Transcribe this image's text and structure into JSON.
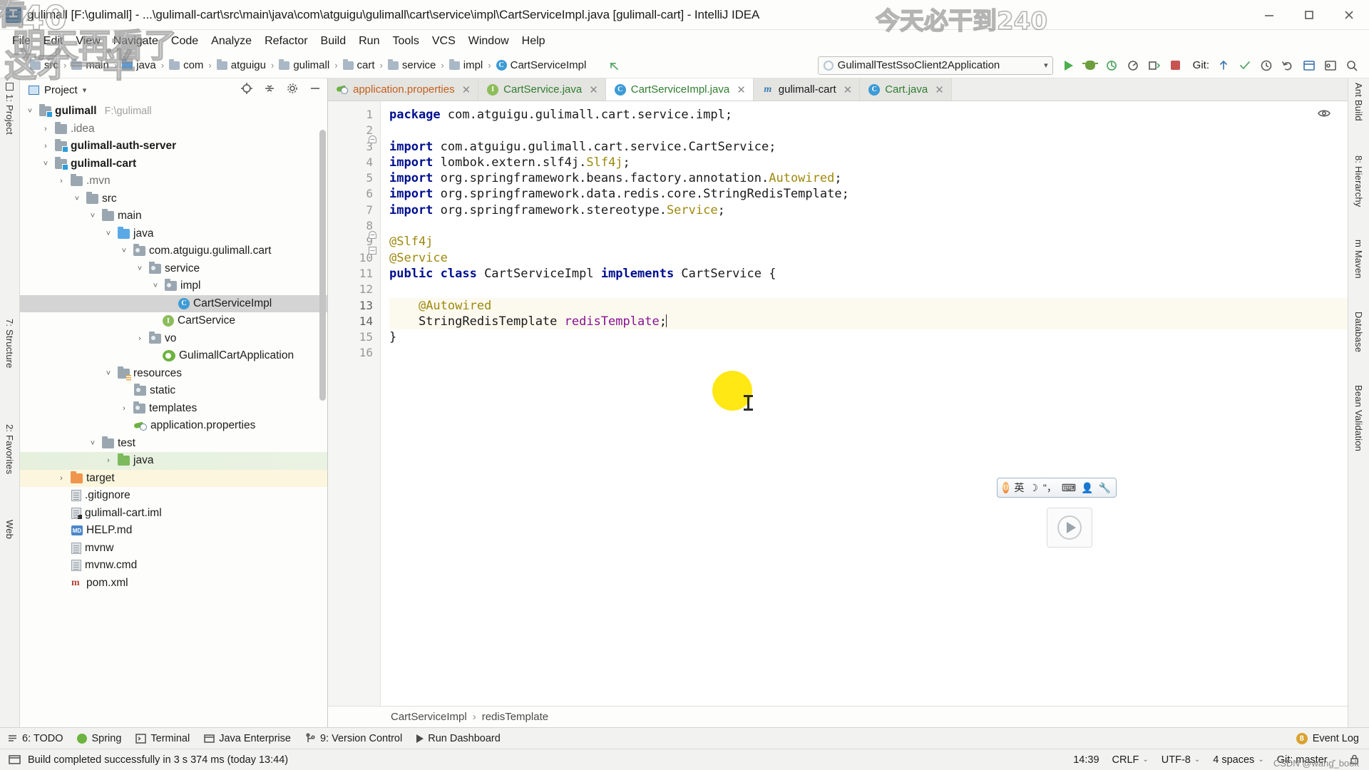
{
  "window": {
    "title": "gulimall [F:\\gulimall] - ...\\gulimall-cart\\src\\main\\java\\com\\atguigu\\gulimall\\cart\\service\\impl\\CartServiceImpl.java [gulimall-cart] - IntelliJ IDEA",
    "minimize": "–",
    "maximize": "□",
    "close": "✕"
  },
  "menubar": {
    "items": [
      {
        "label": "File"
      },
      {
        "label": "Edit"
      },
      {
        "label": "View"
      },
      {
        "label": "Navigate"
      },
      {
        "label": "Code"
      },
      {
        "label": "Analyze"
      },
      {
        "label": "Refactor"
      },
      {
        "label": "Build"
      },
      {
        "label": "Run"
      },
      {
        "label": "Tools"
      },
      {
        "label": "VCS"
      },
      {
        "label": "Window"
      },
      {
        "label": "Help"
      }
    ]
  },
  "navbar": {
    "crumbs": [
      {
        "label": "src",
        "icon": "folder-icon"
      },
      {
        "label": "main",
        "icon": "folder-icon"
      },
      {
        "label": "java",
        "icon": "folder-blue-icon"
      },
      {
        "label": "com",
        "icon": "folder-icon"
      },
      {
        "label": "atguigu",
        "icon": "folder-icon"
      },
      {
        "label": "gulimall",
        "icon": "folder-icon"
      },
      {
        "label": "cart",
        "icon": "folder-icon"
      },
      {
        "label": "service",
        "icon": "folder-icon"
      },
      {
        "label": "impl",
        "icon": "folder-icon"
      },
      {
        "label": "CartServiceImpl",
        "icon": "class-icon"
      }
    ],
    "separator": "›",
    "run_configuration": "GulimallTestSsoClient2Application",
    "run_config_caret": "▾",
    "git_label": "Git:"
  },
  "project_panel": {
    "title": "Project",
    "title_caret": "▾",
    "tree": [
      {
        "label": "gulimall",
        "sub": "F:\\gulimall",
        "twisty": "˅",
        "icon": "module-folder-icon",
        "indent": 0,
        "bold": true
      },
      {
        "label": ".idea",
        "sub": "",
        "twisty": "›",
        "icon": "folder-icon",
        "indent": 1,
        "bold": false,
        "muted": true
      },
      {
        "label": "gulimall-auth-server",
        "sub": "",
        "twisty": "›",
        "icon": "module-folder-icon",
        "indent": 1,
        "bold": true
      },
      {
        "label": "gulimall-cart",
        "sub": "",
        "twisty": "˅",
        "icon": "module-folder-icon",
        "indent": 1,
        "bold": true
      },
      {
        "label": ".mvn",
        "sub": "",
        "twisty": "›",
        "icon": "folder-icon",
        "indent": 2,
        "bold": false,
        "muted": true
      },
      {
        "label": "src",
        "sub": "",
        "twisty": "˅",
        "icon": "folder-icon",
        "indent": 2,
        "bold": false
      },
      {
        "label": "main",
        "sub": "",
        "twisty": "˅",
        "icon": "folder-icon",
        "indent": 3,
        "bold": false
      },
      {
        "label": "java",
        "sub": "",
        "twisty": "˅",
        "icon": "folder-blue-icon",
        "indent": 4,
        "bold": false
      },
      {
        "label": "com.atguigu.gulimall.cart",
        "sub": "",
        "twisty": "˅",
        "icon": "package-icon",
        "indent": 5,
        "bold": false
      },
      {
        "label": "service",
        "sub": "",
        "twisty": "˅",
        "icon": "package-icon",
        "indent": 6,
        "bold": false
      },
      {
        "label": "impl",
        "sub": "",
        "twisty": "˅",
        "icon": "package-icon",
        "indent": 7,
        "bold": false
      },
      {
        "label": "CartServiceImpl",
        "sub": "",
        "twisty": "",
        "icon": "java-class-icon",
        "indent": 8,
        "bold": false,
        "state": "selected",
        "color": "green"
      },
      {
        "label": "CartService",
        "sub": "",
        "twisty": "",
        "icon": "java-interface-icon",
        "indent": 8,
        "bold": false,
        "color": "green"
      },
      {
        "label": "vo",
        "sub": "",
        "twisty": "›",
        "icon": "package-icon",
        "indent": 7,
        "bold": false
      },
      {
        "label": "GulimallCartApplication",
        "sub": "",
        "twisty": "",
        "icon": "spring-boot-icon",
        "indent": 8,
        "bold": false,
        "color": "orange"
      },
      {
        "label": "resources",
        "sub": "",
        "twisty": "˅",
        "icon": "resources-folder-icon",
        "indent": 4,
        "bold": false
      },
      {
        "label": "static",
        "sub": "",
        "twisty": "",
        "icon": "package-icon",
        "indent": 5,
        "bold": false
      },
      {
        "label": "templates",
        "sub": "",
        "twisty": "›",
        "icon": "package-icon",
        "indent": 5,
        "bold": false
      },
      {
        "label": "application.properties",
        "sub": "",
        "twisty": "",
        "icon": "spring-properties-icon",
        "indent": 5,
        "bold": false,
        "color": "orange"
      },
      {
        "label": "test",
        "sub": "",
        "twisty": "˅",
        "icon": "folder-icon",
        "indent": 3,
        "bold": false
      },
      {
        "label": "java",
        "sub": "",
        "twisty": "›",
        "icon": "folder-green-icon",
        "indent": 4,
        "bold": false,
        "state": "green-bg"
      },
      {
        "label": "target",
        "sub": "",
        "twisty": "›",
        "icon": "folder-orange-icon",
        "indent": 2,
        "bold": false,
        "state": "yellow-bg"
      },
      {
        "label": ".gitignore",
        "sub": "",
        "twisty": "",
        "icon": "file-icon",
        "indent": 3,
        "bold": false
      },
      {
        "label": "gulimall-cart.iml",
        "sub": "",
        "twisty": "",
        "icon": "iml-file-icon",
        "indent": 3,
        "bold": false
      },
      {
        "label": "HELP.md",
        "sub": "",
        "twisty": "",
        "icon": "markdown-icon",
        "indent": 3,
        "bold": false
      },
      {
        "label": "mvnw",
        "sub": "",
        "twisty": "",
        "icon": "file-icon",
        "indent": 3,
        "bold": false
      },
      {
        "label": "mvnw.cmd",
        "sub": "",
        "twisty": "",
        "icon": "file-icon",
        "indent": 3,
        "bold": false
      },
      {
        "label": "pom.xml",
        "sub": "",
        "twisty": "",
        "icon": "maven-icon",
        "indent": 3,
        "bold": false
      }
    ]
  },
  "left_rail": [
    {
      "label": "1: Project"
    },
    {
      "label": "7: Structure"
    },
    {
      "label": "2: Favorites"
    },
    {
      "label": "Web"
    }
  ],
  "right_rail": [
    {
      "label": "Ant Build"
    },
    {
      "label": "8: Hierarchy"
    },
    {
      "label": "m Maven"
    },
    {
      "label": "Database"
    },
    {
      "label": "Bean Validation"
    }
  ],
  "editor": {
    "tabs": [
      {
        "label": "application.properties",
        "icon": "spring-properties-icon",
        "active": false,
        "close": "✕"
      },
      {
        "label": "CartService.java",
        "icon": "java-interface-icon",
        "active": false,
        "close": "✕"
      },
      {
        "label": "CartServiceImpl.java",
        "icon": "java-class-icon",
        "active": true,
        "close": "✕"
      },
      {
        "label": "gulimall-cart",
        "icon": "maven-module-icon",
        "active": false,
        "close": "✕"
      },
      {
        "label": "Cart.java",
        "icon": "java-class-icon",
        "active": false,
        "close": "✕"
      }
    ],
    "line_numbers": [
      "1",
      "2",
      "3",
      "4",
      "5",
      "6",
      "7",
      "8",
      "9",
      "10",
      "11",
      "12",
      "13",
      "14",
      "15",
      "16"
    ],
    "lines": [
      {
        "n": 1,
        "text": "package com.atguigu.gulimall.cart.service.impl;"
      },
      {
        "n": 2,
        "text": ""
      },
      {
        "n": 3,
        "text": "import com.atguigu.gulimall.cart.service.CartService;"
      },
      {
        "n": 4,
        "text": "import lombok.extern.slf4j.Slf4j;"
      },
      {
        "n": 5,
        "text": "import org.springframework.beans.factory.annotation.Autowired;"
      },
      {
        "n": 6,
        "text": "import org.springframework.data.redis.core.StringRedisTemplate;"
      },
      {
        "n": 7,
        "text": "import org.springframework.stereotype.Service;"
      },
      {
        "n": 8,
        "text": ""
      },
      {
        "n": 9,
        "text": "@Slf4j"
      },
      {
        "n": 10,
        "text": "@Service"
      },
      {
        "n": 11,
        "text": "public class CartServiceImpl implements CartService {"
      },
      {
        "n": 12,
        "text": ""
      },
      {
        "n": 13,
        "text": "    @Autowired"
      },
      {
        "n": 14,
        "text": "    StringRedisTemplate redisTemplate;"
      },
      {
        "n": 15,
        "text": "}"
      },
      {
        "n": 16,
        "text": ""
      }
    ],
    "caret_line": 14,
    "breadcrumb": [
      "CartServiceImpl",
      "redisTemplate"
    ],
    "breadcrumb_separator": "›"
  },
  "tool_window_bar": {
    "items": [
      {
        "label": "6: TODO",
        "icon": "todo-icon"
      },
      {
        "label": "Spring",
        "icon": "spring-icon"
      },
      {
        "label": "Terminal",
        "icon": "terminal-icon"
      },
      {
        "label": "Java Enterprise",
        "icon": "java-enterprise-icon"
      },
      {
        "label": "9: Version Control",
        "icon": "version-control-icon"
      },
      {
        "label": "Run Dashboard",
        "icon": "run-dashboard-icon"
      }
    ],
    "event_log": "Event Log",
    "event_badge": "8"
  },
  "statusbar": {
    "message": "Build completed successfully in 3 s 374 ms (today 13:44)",
    "time": "14:39",
    "line_separator": "CRLF",
    "encoding": "UTF-8",
    "indent": "4 spaces",
    "git_branch": "Git: master",
    "caret": "⌄"
  },
  "ime": {
    "logo": "U",
    "mode": "英",
    "items": [
      "☽",
      "\"，",
      "⌨",
      "👤",
      "🔧"
    ]
  },
  "watermarks": {
    "top_left_number": "40",
    "top_left_line1": "明天再看了",
    "top_left_line2": "这才一半",
    "top_left_partial": "看",
    "top_right": "今天必干到240",
    "csdn": "CSDN @wang_book"
  }
}
